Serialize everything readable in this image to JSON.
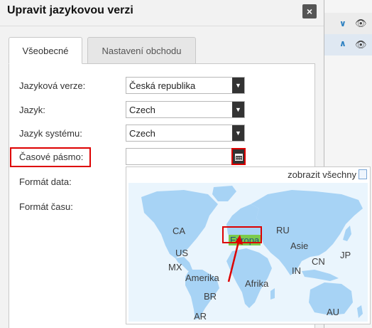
{
  "dialog": {
    "title": "Upravit jazykovou verzi",
    "close_label": "×"
  },
  "tabs": [
    {
      "label": "Všeobecné",
      "active": true
    },
    {
      "label": "Nastavení obchodu",
      "active": false
    }
  ],
  "form": {
    "language_version": {
      "label": "Jazyková verze:",
      "value": "Česká republika"
    },
    "language": {
      "label": "Jazyk:",
      "value": "Czech"
    },
    "system_language": {
      "label": "Jazyk systému:",
      "value": "Czech"
    },
    "timezone": {
      "label": "Časové pásmo:",
      "value": ""
    },
    "date_format": {
      "label": "Formát data:"
    },
    "time_format": {
      "label": "Formát času:"
    }
  },
  "map": {
    "show_all": "zobrazit všechny",
    "regions": {
      "ca": "CA",
      "us": "US",
      "mx": "MX",
      "amerika": "Amerika",
      "br": "BR",
      "ar": "AR",
      "evropa": "Evropa",
      "ru": "RU",
      "asie": "Asie",
      "cn": "CN",
      "in": "IN",
      "jp": "JP",
      "afrika": "Afrika",
      "au": "AU"
    },
    "selected_region": "Evropa"
  },
  "colors": {
    "accent_red": "#dd0000",
    "map_land": "#a7d3f5",
    "map_highlight": "#7ccb4b"
  }
}
